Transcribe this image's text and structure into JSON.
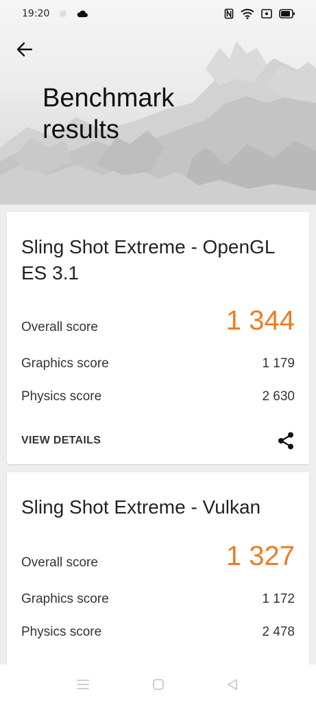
{
  "status_bar": {
    "time": "19:20",
    "icons": [
      "cloud-icon",
      "nfc-icon",
      "wifi-icon",
      "screenshot-icon",
      "battery-icon"
    ]
  },
  "header": {
    "title": "Benchmark results",
    "back_icon": "back-arrow-icon"
  },
  "cards": [
    {
      "title": "Sling Shot Extreme - OpenGL ES 3.1",
      "overall_label": "Overall score",
      "overall_value": "1 344",
      "graphics_label": "Graphics score",
      "graphics_value": "1 179",
      "physics_label": "Physics score",
      "physics_value": "2 630",
      "details_label": "VIEW DETAILS",
      "share_icon": "share-icon"
    },
    {
      "title": "Sling Shot Extreme - Vulkan",
      "overall_label": "Overall score",
      "overall_value": "1 327",
      "graphics_label": "Graphics score",
      "graphics_value": "1 172",
      "physics_label": "Physics score",
      "physics_value": "2 478"
    }
  ],
  "nav_bar": {
    "icons": [
      "menu-icon",
      "home-icon",
      "back-triangle-icon"
    ]
  },
  "colors": {
    "accent": "#ee7b22",
    "background": "#eeeeee",
    "card": "#ffffff"
  }
}
